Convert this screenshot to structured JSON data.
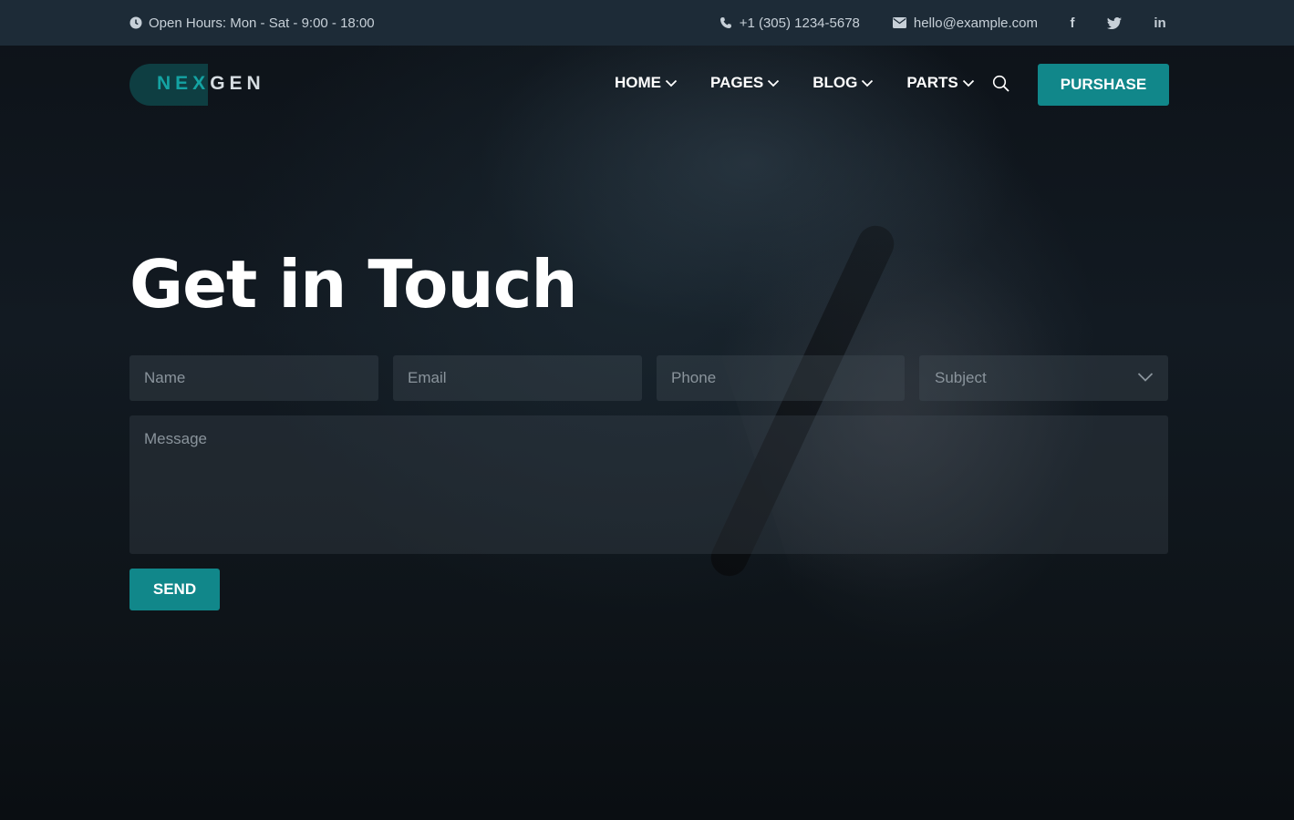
{
  "topbar": {
    "hours": "Open Hours: Mon - Sat - 9:00 - 18:00",
    "phone": "+1 (305) 1234-5678",
    "email": "hello@example.com",
    "social": {
      "facebook": "f",
      "twitter": "twitter-icon",
      "linkedin": "in"
    }
  },
  "logo": {
    "part1": "NEX",
    "part2": "GEN"
  },
  "nav": {
    "items": [
      {
        "label": "HOME"
      },
      {
        "label": "PAGES"
      },
      {
        "label": "BLOG"
      },
      {
        "label": "PARTS"
      }
    ],
    "purchase_label": "PURSHASE"
  },
  "contact": {
    "title": "Get in Touch",
    "name_placeholder": "Name",
    "email_placeholder": "Email",
    "phone_placeholder": "Phone",
    "subject_placeholder": "Subject",
    "message_placeholder": "Message",
    "send_label": "SEND"
  },
  "colors": {
    "accent": "#11878a",
    "topbar_bg": "#1d2b37",
    "logo_accent": "#14a3a3"
  }
}
